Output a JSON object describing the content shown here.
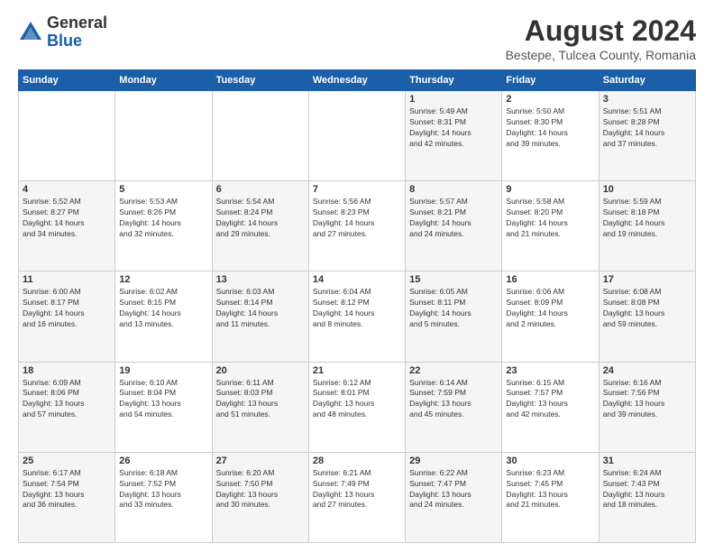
{
  "logo": {
    "general": "General",
    "blue": "Blue"
  },
  "title": "August 2024",
  "subtitle": "Bestepe, Tulcea County, Romania",
  "headers": [
    "Sunday",
    "Monday",
    "Tuesday",
    "Wednesday",
    "Thursday",
    "Friday",
    "Saturday"
  ],
  "weeks": [
    [
      {
        "day": "",
        "info": ""
      },
      {
        "day": "",
        "info": ""
      },
      {
        "day": "",
        "info": ""
      },
      {
        "day": "",
        "info": ""
      },
      {
        "day": "1",
        "info": "Sunrise: 5:49 AM\nSunset: 8:31 PM\nDaylight: 14 hours\nand 42 minutes."
      },
      {
        "day": "2",
        "info": "Sunrise: 5:50 AM\nSunset: 8:30 PM\nDaylight: 14 hours\nand 39 minutes."
      },
      {
        "day": "3",
        "info": "Sunrise: 5:51 AM\nSunset: 8:28 PM\nDaylight: 14 hours\nand 37 minutes."
      }
    ],
    [
      {
        "day": "4",
        "info": "Sunrise: 5:52 AM\nSunset: 8:27 PM\nDaylight: 14 hours\nand 34 minutes."
      },
      {
        "day": "5",
        "info": "Sunrise: 5:53 AM\nSunset: 8:26 PM\nDaylight: 14 hours\nand 32 minutes."
      },
      {
        "day": "6",
        "info": "Sunrise: 5:54 AM\nSunset: 8:24 PM\nDaylight: 14 hours\nand 29 minutes."
      },
      {
        "day": "7",
        "info": "Sunrise: 5:56 AM\nSunset: 8:23 PM\nDaylight: 14 hours\nand 27 minutes."
      },
      {
        "day": "8",
        "info": "Sunrise: 5:57 AM\nSunset: 8:21 PM\nDaylight: 14 hours\nand 24 minutes."
      },
      {
        "day": "9",
        "info": "Sunrise: 5:58 AM\nSunset: 8:20 PM\nDaylight: 14 hours\nand 21 minutes."
      },
      {
        "day": "10",
        "info": "Sunrise: 5:59 AM\nSunset: 8:18 PM\nDaylight: 14 hours\nand 19 minutes."
      }
    ],
    [
      {
        "day": "11",
        "info": "Sunrise: 6:00 AM\nSunset: 8:17 PM\nDaylight: 14 hours\nand 16 minutes."
      },
      {
        "day": "12",
        "info": "Sunrise: 6:02 AM\nSunset: 8:15 PM\nDaylight: 14 hours\nand 13 minutes."
      },
      {
        "day": "13",
        "info": "Sunrise: 6:03 AM\nSunset: 8:14 PM\nDaylight: 14 hours\nand 11 minutes."
      },
      {
        "day": "14",
        "info": "Sunrise: 6:04 AM\nSunset: 8:12 PM\nDaylight: 14 hours\nand 8 minutes."
      },
      {
        "day": "15",
        "info": "Sunrise: 6:05 AM\nSunset: 8:11 PM\nDaylight: 14 hours\nand 5 minutes."
      },
      {
        "day": "16",
        "info": "Sunrise: 6:06 AM\nSunset: 8:09 PM\nDaylight: 14 hours\nand 2 minutes."
      },
      {
        "day": "17",
        "info": "Sunrise: 6:08 AM\nSunset: 8:08 PM\nDaylight: 13 hours\nand 59 minutes."
      }
    ],
    [
      {
        "day": "18",
        "info": "Sunrise: 6:09 AM\nSunset: 8:06 PM\nDaylight: 13 hours\nand 57 minutes."
      },
      {
        "day": "19",
        "info": "Sunrise: 6:10 AM\nSunset: 8:04 PM\nDaylight: 13 hours\nand 54 minutes."
      },
      {
        "day": "20",
        "info": "Sunrise: 6:11 AM\nSunset: 8:03 PM\nDaylight: 13 hours\nand 51 minutes."
      },
      {
        "day": "21",
        "info": "Sunrise: 6:12 AM\nSunset: 8:01 PM\nDaylight: 13 hours\nand 48 minutes."
      },
      {
        "day": "22",
        "info": "Sunrise: 6:14 AM\nSunset: 7:59 PM\nDaylight: 13 hours\nand 45 minutes."
      },
      {
        "day": "23",
        "info": "Sunrise: 6:15 AM\nSunset: 7:57 PM\nDaylight: 13 hours\nand 42 minutes."
      },
      {
        "day": "24",
        "info": "Sunrise: 6:16 AM\nSunset: 7:56 PM\nDaylight: 13 hours\nand 39 minutes."
      }
    ],
    [
      {
        "day": "25",
        "info": "Sunrise: 6:17 AM\nSunset: 7:54 PM\nDaylight: 13 hours\nand 36 minutes."
      },
      {
        "day": "26",
        "info": "Sunrise: 6:18 AM\nSunset: 7:52 PM\nDaylight: 13 hours\nand 33 minutes."
      },
      {
        "day": "27",
        "info": "Sunrise: 6:20 AM\nSunset: 7:50 PM\nDaylight: 13 hours\nand 30 minutes."
      },
      {
        "day": "28",
        "info": "Sunrise: 6:21 AM\nSunset: 7:49 PM\nDaylight: 13 hours\nand 27 minutes."
      },
      {
        "day": "29",
        "info": "Sunrise: 6:22 AM\nSunset: 7:47 PM\nDaylight: 13 hours\nand 24 minutes."
      },
      {
        "day": "30",
        "info": "Sunrise: 6:23 AM\nSunset: 7:45 PM\nDaylight: 13 hours\nand 21 minutes."
      },
      {
        "day": "31",
        "info": "Sunrise: 6:24 AM\nSunset: 7:43 PM\nDaylight: 13 hours\nand 18 minutes."
      }
    ]
  ]
}
